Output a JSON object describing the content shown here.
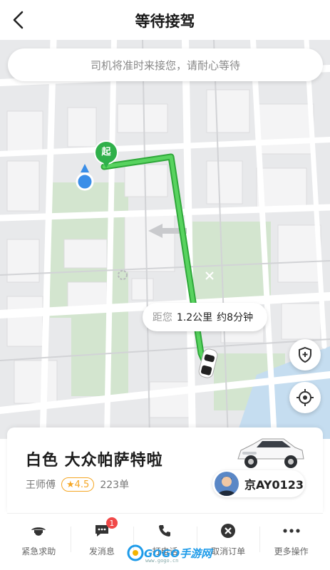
{
  "header": {
    "title": "等待接驾"
  },
  "map": {
    "notice": "司机将准时来接您，请耐心等待",
    "pickup_marker": "起",
    "distance": {
      "prefix": "距您",
      "km": "1.2公里",
      "eta": "约8分钟"
    },
    "route_color": "#3ec24a"
  },
  "driver_card": {
    "car_description": "白色  大众帕萨特啦",
    "driver_name": "王师傅",
    "rating": "★4.5",
    "orders": "223单",
    "plate": "京AY0123"
  },
  "actions": [
    {
      "label": "紧急求助",
      "icon": "police-icon"
    },
    {
      "label": "发消息",
      "icon": "message-icon",
      "badge": "1"
    },
    {
      "label": "打电话",
      "icon": "phone-icon"
    },
    {
      "label": "取消订单",
      "icon": "cancel-icon"
    },
    {
      "label": "更多操作",
      "icon": "more-icon"
    }
  ],
  "watermark": {
    "text": "GOGO手游网",
    "sub": "www.gogo.cn"
  }
}
